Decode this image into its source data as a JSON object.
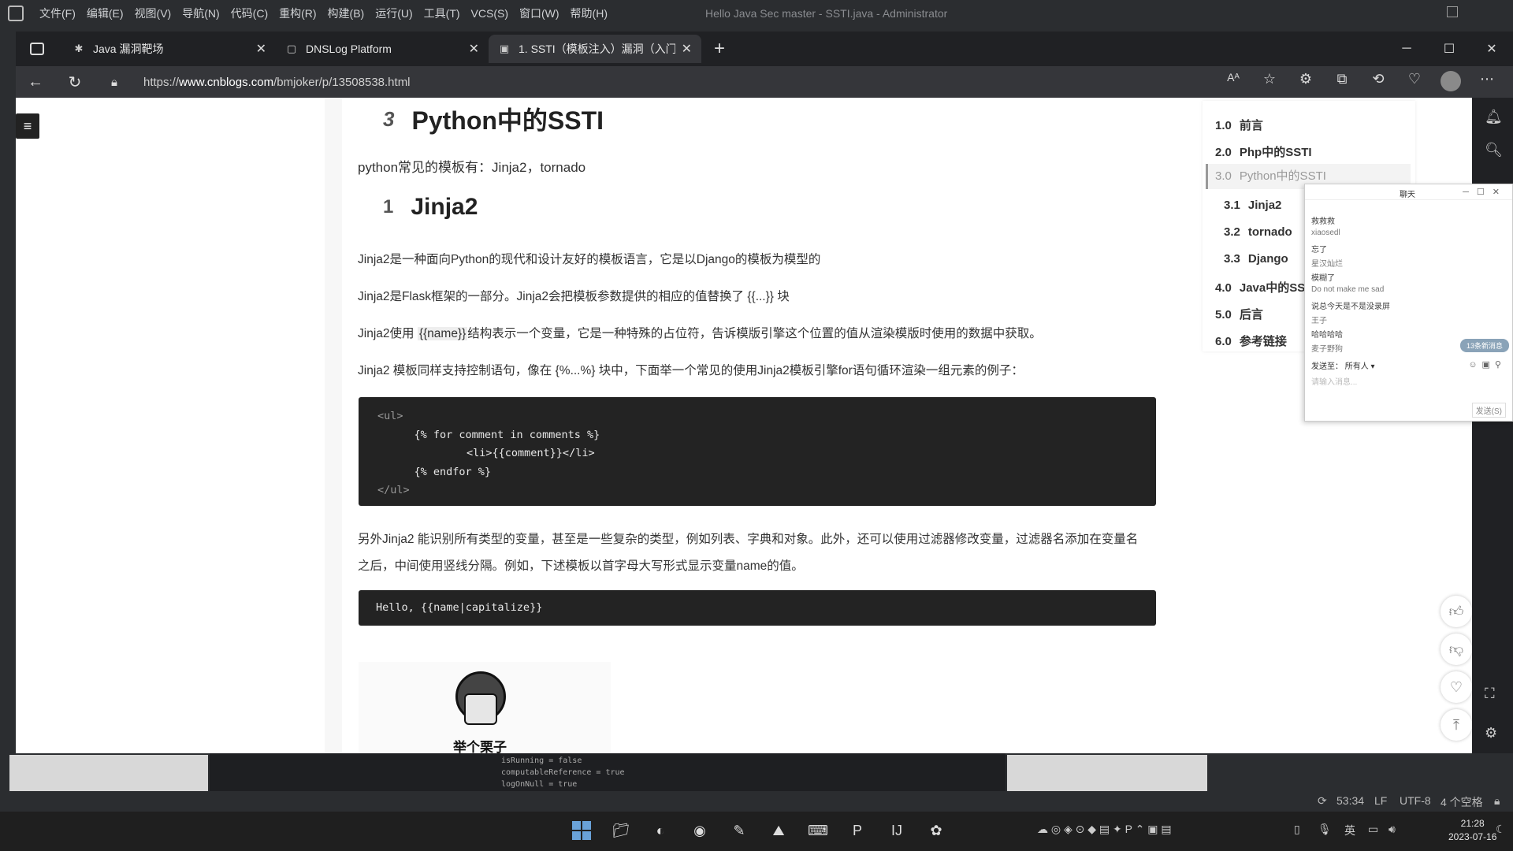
{
  "ide": {
    "menu": [
      "文件(F)",
      "编辑(E)",
      "视图(V)",
      "导航(N)",
      "代码(C)",
      "重构(R)",
      "构建(B)",
      "运行(U)",
      "工具(T)",
      "VCS(S)",
      "窗口(W)",
      "帮助(H)"
    ],
    "title": "Hello Java Sec master - SSTI.java - Administrator",
    "status": {
      "position": "53:34",
      "line_sep": "LF",
      "encoding": "UTF-8",
      "indent": "4 个空格"
    },
    "console_lines": [
      "isRunning = false",
      "computableReference = true",
      "logOnNull = true"
    ]
  },
  "browser": {
    "tabs": [
      {
        "label": "Java 漏洞靶场",
        "icon": "bug-icon"
      },
      {
        "label": "DNSLog Platform",
        "icon": "page-icon"
      },
      {
        "label": "1. SSTI（模板注入）漏洞（入门篇）",
        "icon": "cnblogs-icon"
      }
    ],
    "url_prefix": "https://",
    "url_host": "www.cnblogs.com",
    "url_path": "/bmjoker/p/13508538.html"
  },
  "article": {
    "h_python": {
      "anchor": "3",
      "title": "Python中的SSTI"
    },
    "p_templates": "python常见的模板有：Jinja2，tornado",
    "h_jinja": {
      "anchor": "1",
      "title": "Jinja2"
    },
    "p1": "Jinja2是一种面向Python的现代和设计友好的模板语言，它是以Django的模板为模型的",
    "p2": "Jinja2是Flask框架的一部分。Jinja2会把模板参数提供的相应的值替换了 {{...}} 块",
    "p3_a": "Jinja2使用 ",
    "p3_code": "{{name}}",
    "p3_b": "结构表示一个变量，它是一种特殊的占位符，告诉模版引擎这个位置的值从渲染模版时使用的数据中获取。",
    "p4": "Jinja2 模板同样支持控制语句，像在 {%...%} 块中，下面举一个常见的使用Jinja2模板引擎for语句循环渲染一组元素的例子：",
    "code1": [
      "<ul>",
      "    {% for comment in comments %}",
      "        <li>{{comment}}</li>",
      "    {% endfor %}",
      "</ul>"
    ],
    "p5_line1": "另外Jinja2 能识别所有类型的变量，甚至是一些复杂的类型，例如列表、字典和对象。此外，还可以使用过滤器修改变量，过滤器名添加在变量名",
    "p5_line2": "之后，中间使用竖线分隔。例如，下述模板以首字母大写形式显示变量name的值。",
    "code2": "Hello, {{name|capitalize}}",
    "meme_caption": "举个栗子"
  },
  "toc": [
    {
      "num": "1.0",
      "label": "前言"
    },
    {
      "num": "2.0",
      "label": "Php中的SSTI"
    },
    {
      "num": "3.0",
      "label": "Python中的SSTI"
    },
    {
      "num": "3.1",
      "label": "Jinja2"
    },
    {
      "num": "3.2",
      "label": "tornado"
    },
    {
      "num": "3.3",
      "label": "Django"
    },
    {
      "num": "4.0",
      "label": "Java中的SSTI"
    },
    {
      "num": "5.0",
      "label": "后言"
    },
    {
      "num": "6.0",
      "label": "参考链接"
    }
  ],
  "chat": {
    "title": "聊天",
    "messages": [
      "救救救",
      "xiaosedl",
      "忘了",
      "星汉灿烂",
      "模糊了",
      "Do not make me sad",
      "说总今天是不是没录屏",
      "王子",
      "哈哈哈哈",
      "麦子野狗"
    ],
    "bubble": "13条新消息",
    "send_to_label": "发送至：",
    "send_to_value": "所有人",
    "input_placeholder": "请输入消息...",
    "send_button": "发送(S)"
  },
  "taskbar": {
    "ime": "英",
    "time": "21:28",
    "date": "2023-07-16"
  }
}
